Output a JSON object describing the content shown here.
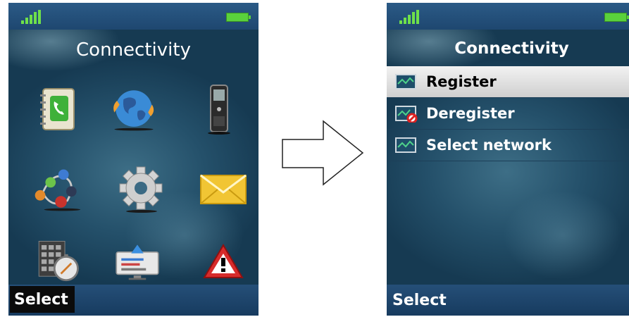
{
  "left_screen": {
    "title": "Connectivity",
    "softkey": "Select",
    "icons": [
      "contacts-icon",
      "globe-network-icon",
      "phone-icon",
      "connectivity-nodes-icon",
      "settings-gear-icon",
      "message-envelope-icon",
      "calculator-clock-icon",
      "network-connect-icon",
      "warning-icon"
    ]
  },
  "right_screen": {
    "title": "Connectivity",
    "softkey": "Select",
    "menu": [
      {
        "label": "Register",
        "selected": true,
        "icon": "register-icon"
      },
      {
        "label": "Deregister",
        "selected": false,
        "icon": "deregister-icon"
      },
      {
        "label": "Select network",
        "selected": false,
        "icon": "select-network-icon"
      }
    ]
  },
  "colors": {
    "signal": "#6fe04a",
    "battery": "#5ad13c",
    "header": "#2b5a86",
    "softkey": "#1e4770"
  }
}
